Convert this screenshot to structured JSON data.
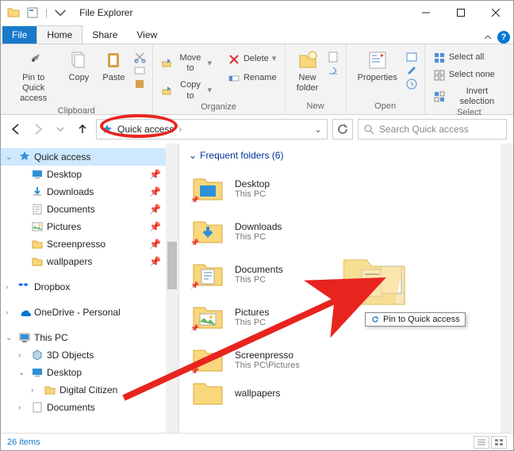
{
  "title": "File Explorer",
  "menu": {
    "file": "File",
    "home": "Home",
    "share": "Share",
    "view": "View"
  },
  "ribbon": {
    "pin": "Pin to Quick\naccess",
    "copy": "Copy",
    "paste": "Paste",
    "moveto": "Move to",
    "copyto": "Copy to",
    "delete": "Delete",
    "rename": "Rename",
    "newfolder": "New\nfolder",
    "properties": "Properties",
    "selectall": "Select all",
    "selectnone": "Select none",
    "invertsel": "Invert selection",
    "groups": {
      "clipboard": "Clipboard",
      "organize": "Organize",
      "new": "New",
      "open": "Open",
      "select": "Select"
    }
  },
  "address": {
    "crumb": "Quick access"
  },
  "search": {
    "placeholder": "Search Quick access"
  },
  "navtree": {
    "quickaccess": "Quick access",
    "desktop": "Desktop",
    "downloads": "Downloads",
    "documents": "Documents",
    "pictures": "Pictures",
    "screenpresso": "Screenpresso",
    "wallpapers": "wallpapers",
    "dropbox": "Dropbox",
    "onedrive": "OneDrive - Personal",
    "thispc": "This PC",
    "3dobjects": "3D Objects",
    "pcdesktop": "Desktop",
    "digitalcitizen": "Digital Citizen",
    "pcdocuments": "Documents"
  },
  "content": {
    "header": "Frequent folders (6)",
    "items": [
      {
        "name": "Desktop",
        "loc": "This PC"
      },
      {
        "name": "Downloads",
        "loc": "This PC"
      },
      {
        "name": "Documents",
        "loc": "This PC"
      },
      {
        "name": "Pictures",
        "loc": "This PC"
      },
      {
        "name": "Screenpresso",
        "loc": "This PC\\Pictures"
      },
      {
        "name": "wallpapers",
        "loc": ""
      }
    ]
  },
  "drag": {
    "tooltip": "Pin to Quick access"
  },
  "status": {
    "items": "26 items"
  },
  "colors": {
    "accent": "#1979ca",
    "highlight": "#cde8ff",
    "annotation": "#e8241f"
  }
}
